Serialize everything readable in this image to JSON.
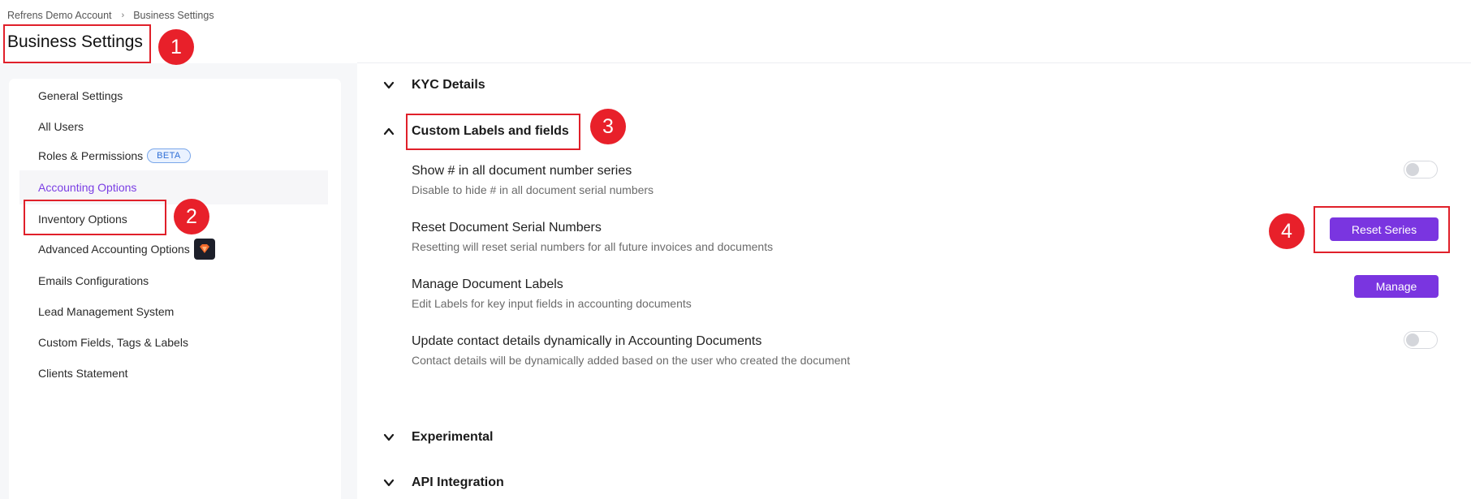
{
  "breadcrumb": [
    "Refrens Demo Account",
    "Business Settings"
  ],
  "page_title": "Business Settings",
  "sidebar": {
    "items": [
      {
        "label": "General Settings"
      },
      {
        "label": "All Users"
      },
      {
        "label": "Roles & Permissions",
        "badge": "BETA"
      },
      {
        "label": "Accounting Options",
        "active": true
      },
      {
        "label": "Inventory Options"
      },
      {
        "label": "Advanced Accounting Options",
        "icon": "premium-gem-icon"
      },
      {
        "label": "Emails Configurations"
      },
      {
        "label": "Lead Management System"
      },
      {
        "label": "Custom Fields, Tags & Labels"
      },
      {
        "label": "Clients Statement"
      }
    ]
  },
  "sections": {
    "kyc": {
      "title": "KYC Details",
      "expanded": false
    },
    "custom_labels": {
      "title": "Custom Labels and fields",
      "expanded": true
    },
    "experimental": {
      "title": "Experimental",
      "expanded": false
    },
    "api": {
      "title": "API Integration",
      "expanded": false
    }
  },
  "settings": [
    {
      "title": "Show # in all document number series",
      "desc": "Disable to hide # in all document serial numbers",
      "control": "toggle",
      "on": false
    },
    {
      "title": "Reset Document Serial Numbers",
      "desc": "Resetting will reset serial numbers for all future invoices and documents",
      "control": "button",
      "button_label": "Reset Series"
    },
    {
      "title": "Manage Document Labels",
      "desc": "Edit Labels for key input fields in accounting documents",
      "control": "button",
      "button_label": "Manage"
    },
    {
      "title": "Update contact details dynamically in Accounting Documents",
      "desc": "Contact details will be dynamically added based on the user who created the document",
      "control": "toggle",
      "on": false
    }
  ],
  "annotations": [
    "1",
    "2",
    "3",
    "4"
  ],
  "colors": {
    "accent": "#7a35e0",
    "annotation": "#e8202a"
  }
}
